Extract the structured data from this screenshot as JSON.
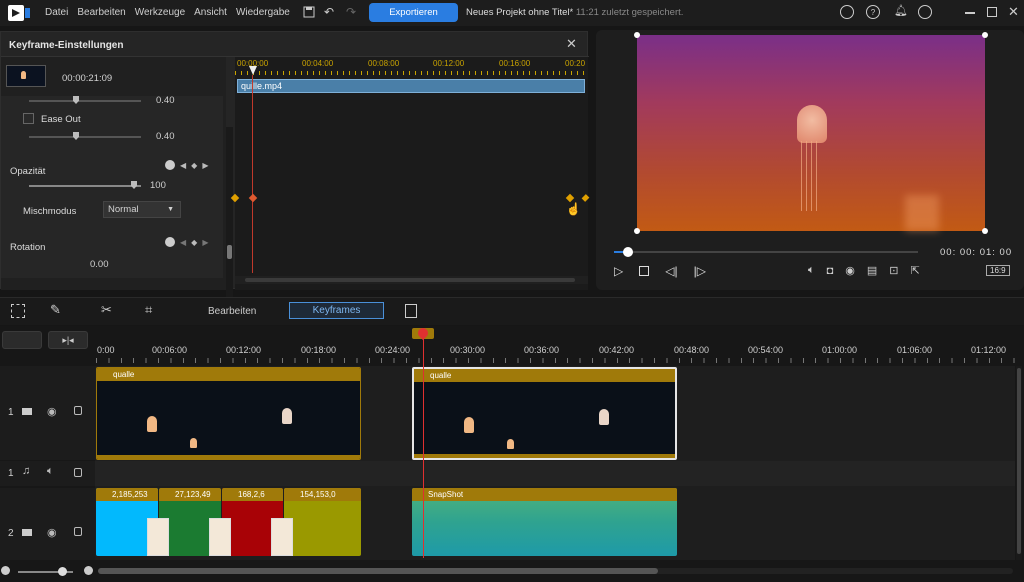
{
  "app": {
    "title": "Neues Projekt ohne Titel*",
    "saved_status": "11:21 zuletzt gespeichert."
  },
  "menu": [
    "Datei",
    "Bearbeiten",
    "Werkzeuge",
    "Ansicht",
    "Wiedergabe"
  ],
  "toolbar_top": {
    "export_label": "Exportieren"
  },
  "keyframe_panel": {
    "title": "Keyframe-Einstellungen",
    "clip_time": "00:00:21:09",
    "clip_name": "quille.mp4",
    "ruler": [
      "00:00:00",
      "00:04:00",
      "00:08:00",
      "00:12:00",
      "00:16:00",
      "00:20"
    ],
    "props": {
      "value_top": "0.40",
      "ease_out_label": "Ease Out",
      "ease_out_value": "0.40",
      "opacity_label": "Opazität",
      "opacity_value": "100",
      "blend_label": "Mischmodus",
      "blend_value": "Normal",
      "rotation_label": "Rotation",
      "rotation_value": "0.00"
    }
  },
  "preview": {
    "timecode": "00: 00: 01: 00",
    "aspect": "16:9",
    "scrub_progress": 0.04
  },
  "edit_toolbar": {
    "tab_edit": "Bearbeiten",
    "tab_keyframes": "Keyframes"
  },
  "timeline": {
    "ruler": [
      "0:00",
      "00:06:00",
      "00:12:00",
      "00:18:00",
      "00:24:00",
      "00:30:00",
      "00:36:00",
      "00:42:00",
      "00:48:00",
      "00:54:00",
      "01:00:00",
      "01:06:00",
      "01:12:00"
    ],
    "tracks": [
      {
        "number": "1",
        "type": "video"
      },
      {
        "number": "1",
        "type": "audio"
      },
      {
        "number": "2",
        "type": "video"
      }
    ],
    "clips": {
      "video_a": "qualle",
      "video_b": "qualle",
      "color_1": "2,185,253",
      "color_2": "27,123,49",
      "color_3": "168,2,6",
      "color_4": "154,153,0",
      "snapshot": "SnapShot"
    }
  },
  "colors": {
    "accent": "#2a7de1",
    "clip": "#a07a0a",
    "playhead": "#e03030"
  }
}
